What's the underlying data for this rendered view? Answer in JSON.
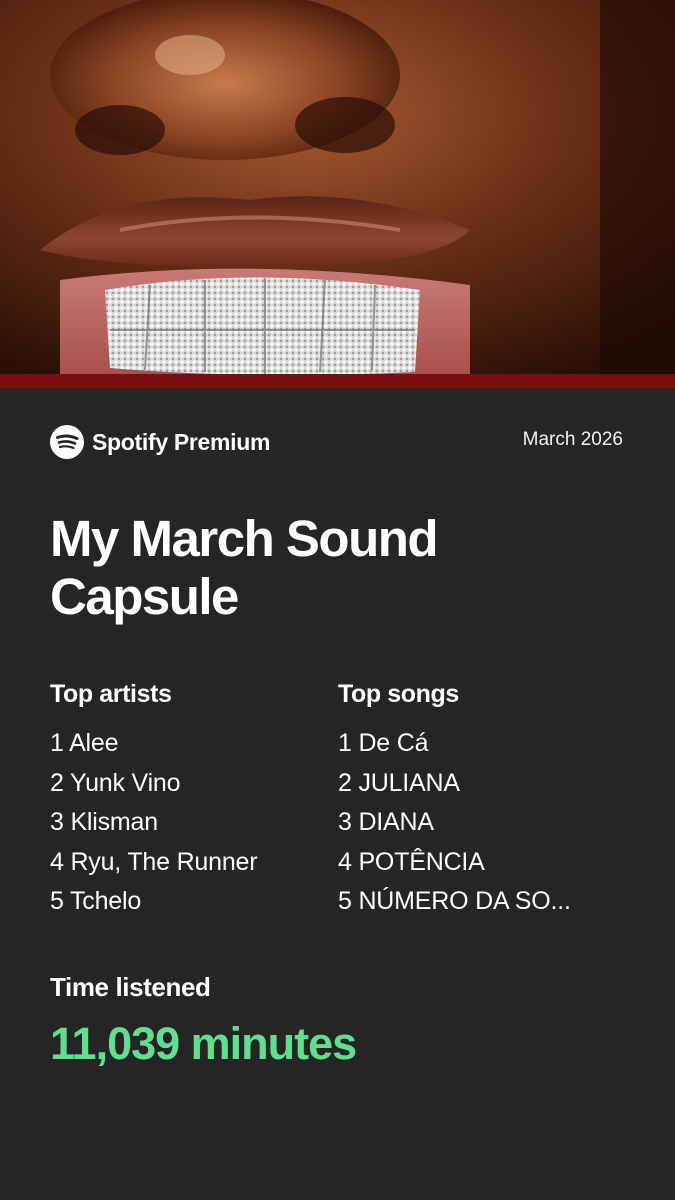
{
  "brand": {
    "name": "Spotify",
    "tier": "Premium",
    "icon": "spotify-logo-icon"
  },
  "period": "March 2026",
  "title": "My March Sound Capsule",
  "top_artists": {
    "heading": "Top artists",
    "items": [
      "1 Alee",
      "2 Yunk Vino",
      "3 Klisman",
      "4 Ryu, The Runner",
      "5 Tchelo"
    ]
  },
  "top_songs": {
    "heading": "Top songs",
    "items": [
      "1 De Cá",
      "2 JULIANA",
      "3 DIANA",
      "4 POTÊNCIA",
      "5 NÚMERO DA SO..."
    ]
  },
  "time_listened": {
    "heading": "Time listened",
    "value": "11,039 minutes"
  },
  "colors": {
    "background": "#252525",
    "accent": "#5fe08f",
    "stripe": "#7a0d0d"
  }
}
